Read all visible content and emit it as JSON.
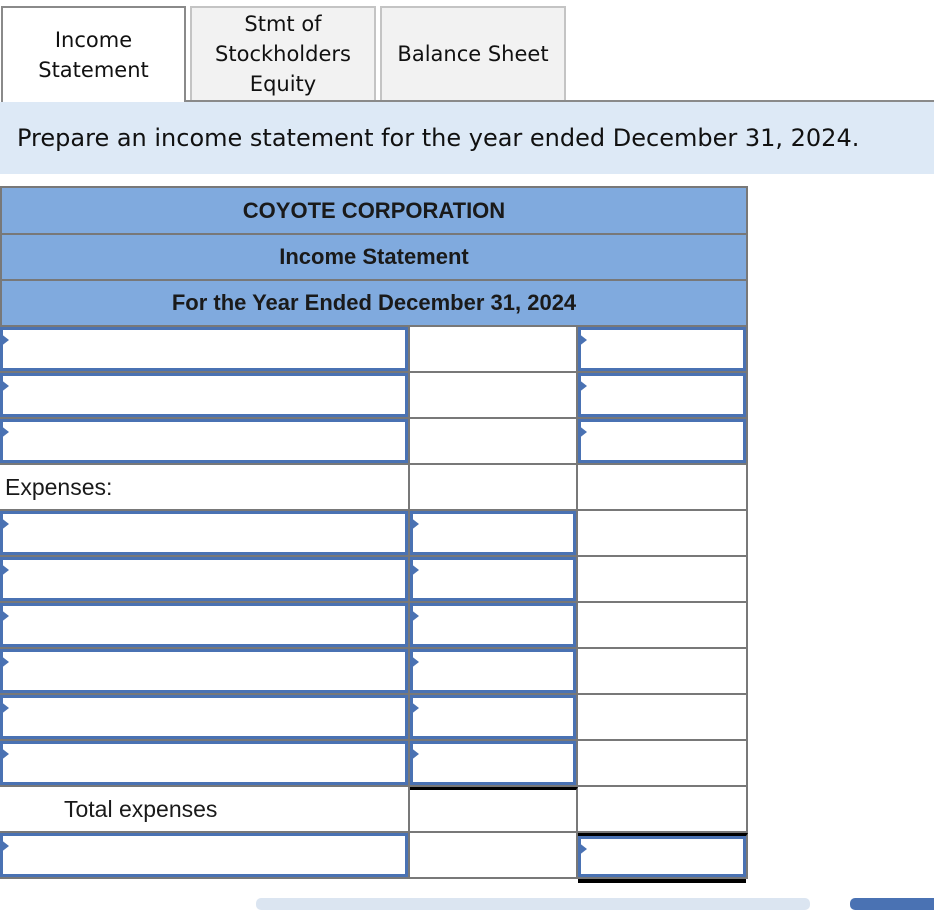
{
  "tabs": [
    {
      "label": "Income\nStatement",
      "active": true
    },
    {
      "label": "Stmt of\nStockholders\nEquity",
      "active": false
    },
    {
      "label": "Balance Sheet",
      "active": false
    }
  ],
  "instruction": "Prepare an income statement for the year ended December 31, 2024.",
  "statement": {
    "company": "COYOTE CORPORATION",
    "title": "Income Statement",
    "period": "For the Year Ended December 31, 2024",
    "rows": [
      {
        "label": "",
        "col1": "input",
        "col2": "static",
        "col3": "input",
        "value1": "",
        "value3": ""
      },
      {
        "label": "",
        "col1": "input",
        "col2": "static",
        "col3": "input",
        "value1": "",
        "value3": ""
      },
      {
        "label": "",
        "col1": "input",
        "col2": "static",
        "col3": "input",
        "value1": "",
        "value3": ""
      },
      {
        "label": "Expenses:",
        "col1": "text",
        "col2": "static",
        "col3": "static"
      },
      {
        "label": "",
        "col1": "input",
        "col2": "input",
        "col3": "static",
        "value1": "",
        "value2": ""
      },
      {
        "label": "",
        "col1": "input",
        "col2": "input",
        "col3": "static",
        "value1": "",
        "value2": ""
      },
      {
        "label": "",
        "col1": "input",
        "col2": "input",
        "col3": "static",
        "value1": "",
        "value2": ""
      },
      {
        "label": "",
        "col1": "input",
        "col2": "input",
        "col3": "static",
        "value1": "",
        "value2": ""
      },
      {
        "label": "",
        "col1": "input",
        "col2": "input",
        "col3": "static",
        "value1": "",
        "value2": ""
      },
      {
        "label": "",
        "col1": "input",
        "col2": "input",
        "col3": "static",
        "value1": "",
        "value2": ""
      },
      {
        "label": "Total expenses",
        "col1": "text-indent",
        "col2": "static",
        "col3": "static"
      },
      {
        "label": "",
        "col1": "input",
        "col2": "static",
        "col3": "input",
        "value1": "",
        "value3": ""
      }
    ]
  },
  "colors": {
    "header_bg": "#80aade",
    "instruction_bg": "#dde9f6",
    "input_border": "#4a72b3",
    "grid_line": "#787878"
  }
}
